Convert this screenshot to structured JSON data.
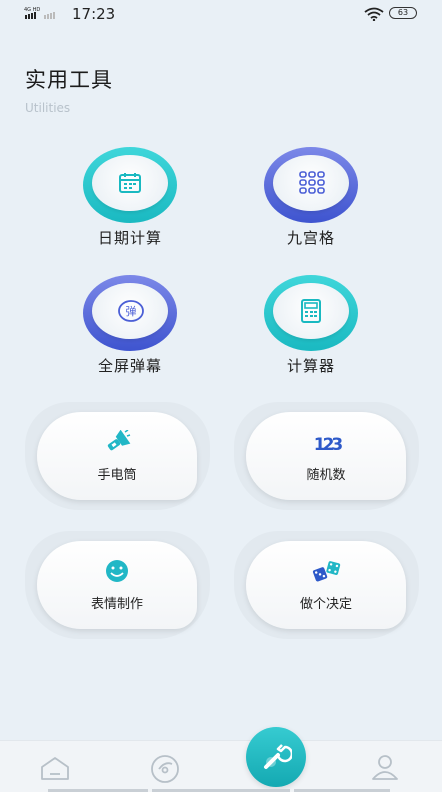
{
  "status": {
    "network": "4G",
    "time": "17:23",
    "battery": "63"
  },
  "header": {
    "title": "实用工具",
    "subtitle": "Utilities"
  },
  "round_tools": [
    {
      "label": "日期计算",
      "icon": "calendar-icon",
      "color": "#1ab9c1"
    },
    {
      "label": "九宫格",
      "icon": "grid-icon",
      "color": "#3e54cf"
    },
    {
      "label": "全屏弹幕",
      "icon": "bullet-comment-icon",
      "icon_text": "弹",
      "color": "#3e54cf"
    },
    {
      "label": "计算器",
      "icon": "calculator-icon",
      "color": "#1ab9c1"
    }
  ],
  "card_tools": [
    {
      "label": "手电筒",
      "icon": "flashlight-icon"
    },
    {
      "label": "随机数",
      "icon": "random-number-icon",
      "icon_text": "123"
    },
    {
      "label": "表情制作",
      "icon": "emoji-icon"
    },
    {
      "label": "做个决定",
      "icon": "dice-icon"
    }
  ],
  "nav": {
    "items": [
      "home-icon",
      "compass-icon",
      "tools-icon",
      "profile-icon"
    ],
    "active": "tools-icon",
    "accent": "#1ab9c1"
  }
}
